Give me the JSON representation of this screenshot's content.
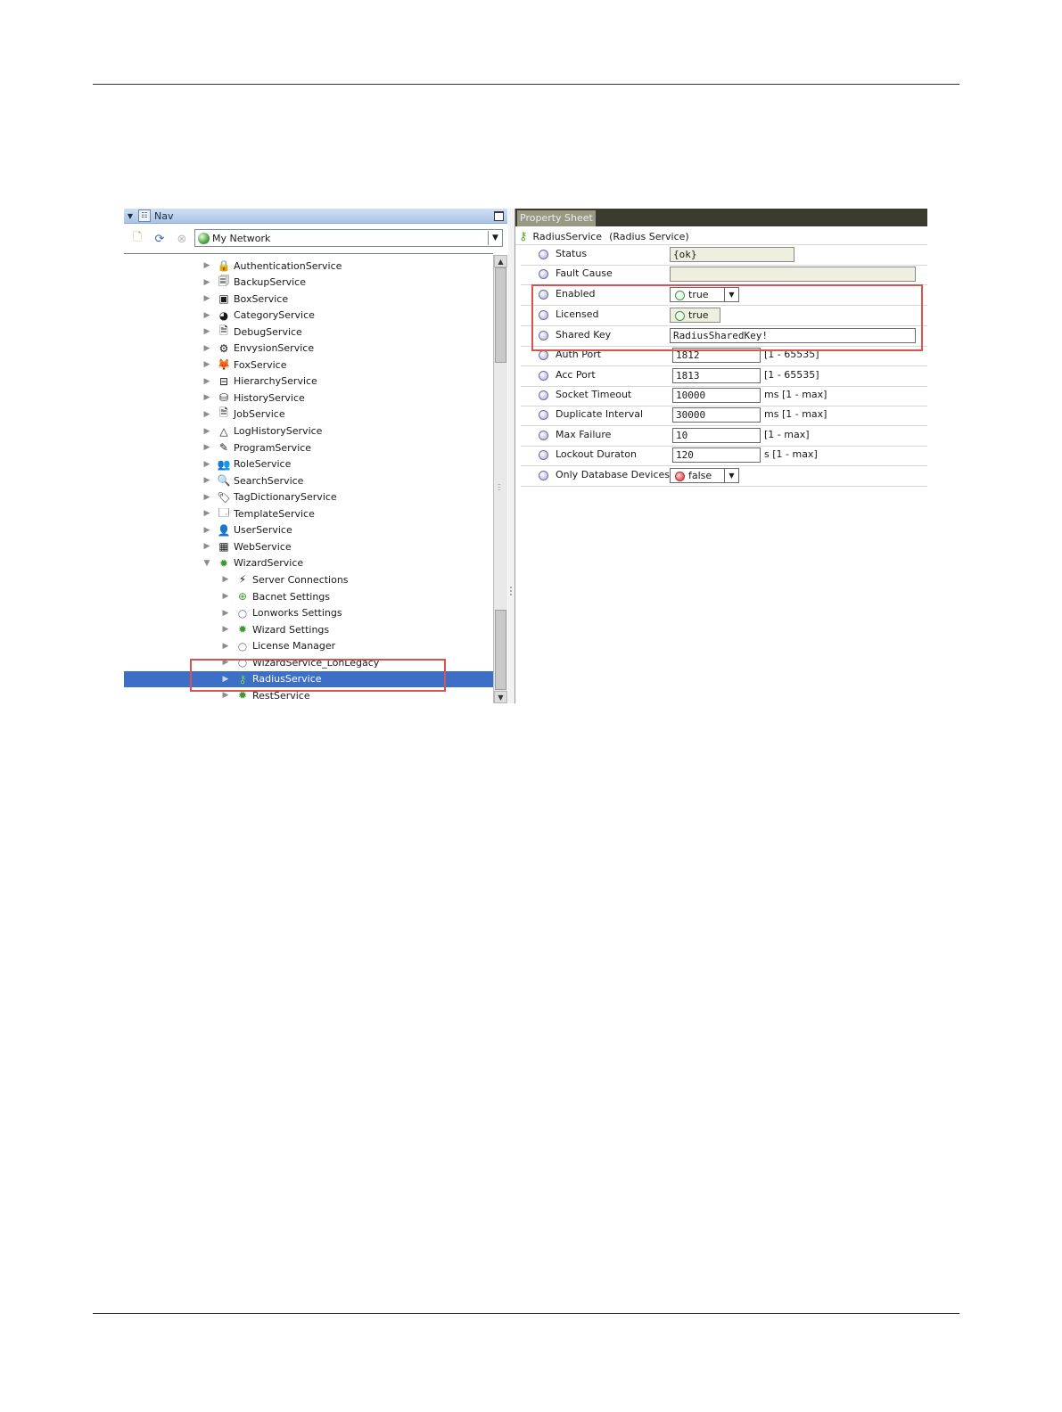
{
  "nav": {
    "title": "Nav",
    "network_label": "My Network",
    "items": [
      {
        "label": "AuthenticationService",
        "icon": "lock-icon",
        "glyph": "🔒",
        "level": 0,
        "expanded": false
      },
      {
        "label": "BackupService",
        "icon": "backup-icon",
        "glyph": "🗐",
        "level": 0,
        "expanded": false
      },
      {
        "label": "BoxService",
        "icon": "box-icon",
        "glyph": "▣",
        "level": 0,
        "expanded": false
      },
      {
        "label": "CategoryService",
        "icon": "category-icon",
        "glyph": "◕",
        "level": 0,
        "expanded": false
      },
      {
        "label": "DebugService",
        "icon": "debug-icon",
        "glyph": "🗎",
        "level": 0,
        "expanded": false
      },
      {
        "label": "EnvysionService",
        "icon": "envysion-icon",
        "glyph": "⚙",
        "level": 0,
        "expanded": false
      },
      {
        "label": "FoxService",
        "icon": "fox-icon",
        "glyph": "🦊",
        "level": 0,
        "expanded": false
      },
      {
        "label": "HierarchyService",
        "icon": "hierarchy-icon",
        "glyph": "⊟",
        "level": 0,
        "expanded": false
      },
      {
        "label": "HistoryService",
        "icon": "history-icon",
        "glyph": "⛁",
        "level": 0,
        "expanded": false
      },
      {
        "label": "JobService",
        "icon": "job-icon",
        "glyph": "🗎",
        "level": 0,
        "expanded": false
      },
      {
        "label": "LogHistoryService",
        "icon": "log-history-icon",
        "glyph": "△",
        "level": 0,
        "expanded": false
      },
      {
        "label": "ProgramService",
        "icon": "program-icon",
        "glyph": "✎",
        "level": 0,
        "expanded": false
      },
      {
        "label": "RoleService",
        "icon": "role-icon",
        "glyph": "👥",
        "level": 0,
        "expanded": false
      },
      {
        "label": "SearchService",
        "icon": "search-icon",
        "glyph": "🔍",
        "level": 0,
        "expanded": false
      },
      {
        "label": "TagDictionaryService",
        "icon": "tag-icon",
        "glyph": "🏷",
        "level": 0,
        "expanded": false
      },
      {
        "label": "TemplateService",
        "icon": "template-icon",
        "glyph": "🗔",
        "level": 0,
        "expanded": false
      },
      {
        "label": "UserService",
        "icon": "user-icon",
        "glyph": "👤",
        "level": 0,
        "expanded": false
      },
      {
        "label": "WebService",
        "icon": "web-icon",
        "glyph": "▦",
        "level": 0,
        "expanded": false
      },
      {
        "label": "WizardService",
        "icon": "gear-icon",
        "glyph": "✹",
        "level": 0,
        "expanded": true
      },
      {
        "label": "Server Connections",
        "icon": "connections-icon",
        "glyph": "⚡",
        "level": 1,
        "expanded": false
      },
      {
        "label": "Bacnet Settings",
        "icon": "bacnet-icon",
        "glyph": "⊕",
        "level": 1,
        "expanded": false
      },
      {
        "label": "Lonworks Settings",
        "icon": "ball-icon",
        "glyph": "○",
        "level": 1,
        "expanded": false
      },
      {
        "label": "Wizard Settings",
        "icon": "wizard-gear-icon",
        "glyph": "✹",
        "level": 1,
        "expanded": false
      },
      {
        "label": "License Manager",
        "icon": "ball-icon",
        "glyph": "○",
        "level": 1,
        "expanded": false
      },
      {
        "label": "WizardService_LonLegacy",
        "icon": "ball-icon",
        "glyph": "○",
        "level": 1,
        "expanded": false
      },
      {
        "label": "RadiusService",
        "icon": "key-icon",
        "glyph": "⚷",
        "level": 1,
        "expanded": false,
        "selected": true
      },
      {
        "label": "RestService",
        "icon": "rest-gear-icon",
        "glyph": "✹",
        "level": 1,
        "expanded": false
      }
    ]
  },
  "property_sheet": {
    "tab": "Property Sheet",
    "component_name": "RadiusService",
    "component_type": "(Radius Service)",
    "rows": [
      {
        "label": "Status",
        "value": "{ok}",
        "kind": "ro"
      },
      {
        "label": "Fault Cause",
        "value": "",
        "kind": "ro"
      },
      {
        "label": "Enabled",
        "value": "true",
        "kind": "bool-drop"
      },
      {
        "label": "Licensed",
        "value": "true",
        "kind": "bool"
      },
      {
        "label": "Shared Key",
        "value": "RadiusSharedKey!",
        "kind": "text-wide"
      },
      {
        "label": "Auth Port",
        "value": "1812",
        "kind": "text",
        "range": "[1 - 65535]"
      },
      {
        "label": "Acc Port",
        "value": "1813",
        "kind": "text",
        "range": "[1 - 65535]"
      },
      {
        "label": "Socket Timeout",
        "value": "10000",
        "kind": "text",
        "range": "ms [1 - max]"
      },
      {
        "label": "Duplicate Interval",
        "value": "30000",
        "kind": "text",
        "range": "ms [1 - max]"
      },
      {
        "label": "Max Failure",
        "value": "10",
        "kind": "text",
        "range": "[1 - max]"
      },
      {
        "label": "Lockout Duraton",
        "value": "120",
        "kind": "text",
        "range": "s [1 - max]"
      },
      {
        "label": "Only Database Devices",
        "value": "false",
        "kind": "bool-drop-false"
      }
    ]
  },
  "colors": {
    "highlight": "#d9534f",
    "selection": "#3b6fc8"
  }
}
